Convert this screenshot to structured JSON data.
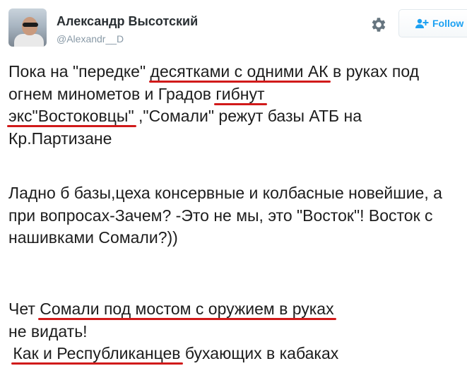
{
  "user": {
    "display_name": "Александр Высотский",
    "handle": "@Alexandr__D"
  },
  "actions": {
    "follow_label": "Follow"
  },
  "icons": {
    "settings": "gear-icon",
    "follow": "user-plus-icon"
  },
  "colors": {
    "underline": "#d11a1a",
    "follow_accent": "#1da1f2"
  },
  "tweet": {
    "p1": {
      "t1": "Пока на \"передке\" ",
      "u1": "десятками с одними АК",
      "t2": " в руках под огнем минометов и Градов ",
      "u2": "гибнут",
      "u3": "экс\"Востоковцы\"",
      "t3": " ,\"Сомали\" режут базы АТБ на Кр.Партизане"
    },
    "p2": "Ладно б базы,цеха консервные и колбасные новейшие, а при вопросах-Зачем? -Это не мы, это \"Восток\"! Восток с нашивками Сомали?))",
    "p3": {
      "t1": "Чет ",
      "u1": "Сомали под мостом с оружием в руках",
      "t2": " не видать!",
      "u2": "Как и Республиканцев",
      "t3": " бухающих в кабаках"
    }
  }
}
